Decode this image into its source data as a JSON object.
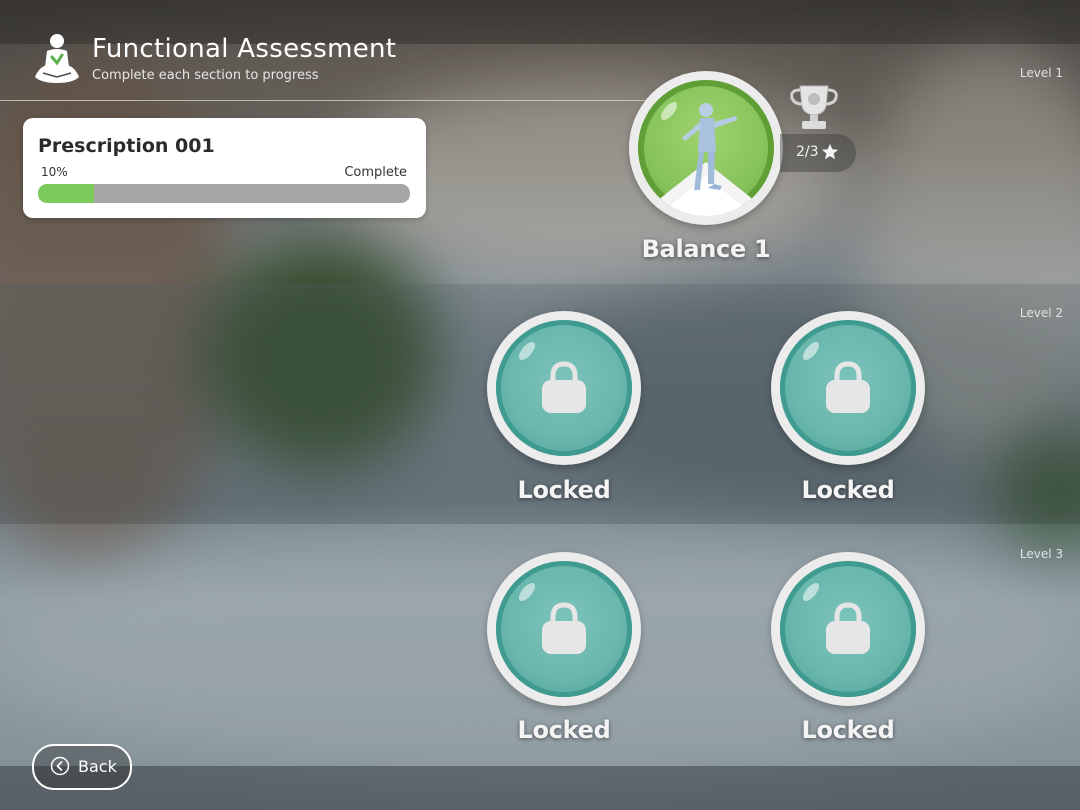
{
  "header": {
    "title": "Functional Assessment",
    "subtitle": "Complete each section to progress",
    "logo_icon": "meditation-figure-icon"
  },
  "prescription": {
    "title": "Prescription 001",
    "progress_label": "10%",
    "progress_value": 0.15,
    "status_label": "Complete",
    "fill_color": "#7ccb5b"
  },
  "levels": [
    {
      "label": "Level 1"
    },
    {
      "label": "Level 2"
    },
    {
      "label": "Level 3"
    }
  ],
  "active_node": {
    "label": "Balance 1",
    "stars_text": "2/3",
    "trophy_icon": "trophy-icon",
    "star_icon": "star-icon"
  },
  "locked_nodes": [
    {
      "label": "Locked"
    },
    {
      "label": "Locked"
    },
    {
      "label": "Locked"
    },
    {
      "label": "Locked"
    }
  ],
  "back_button": {
    "label": "Back",
    "icon": "chevron-left-circle-icon"
  },
  "colors": {
    "active_green": "#86c25a",
    "locked_teal": "#6ab7ad"
  }
}
